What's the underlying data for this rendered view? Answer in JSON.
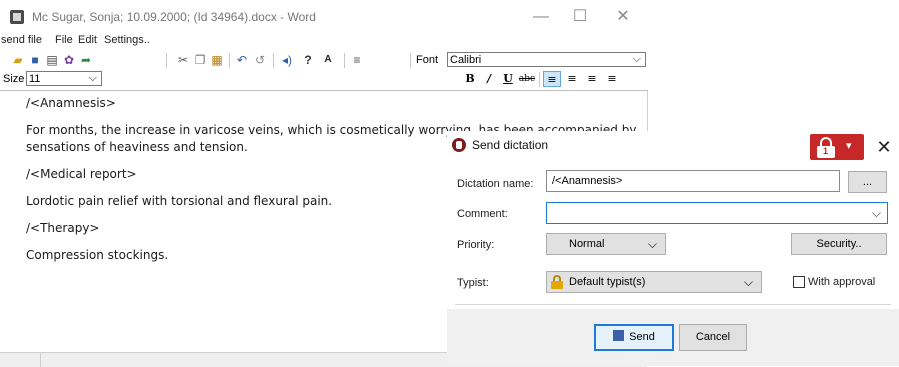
{
  "word": {
    "window_title": "Mc Sugar, Sonja; 10.09.2000; (Id 34964).docx - Word",
    "controls": {
      "minimize": "—",
      "maximize": "☐",
      "close": "✕"
    },
    "menu": [
      "send file",
      "File",
      "Edit",
      "Settings.."
    ],
    "toolbar": {
      "font_label": "Font",
      "font_value": "Calibri",
      "size_label": "Size",
      "size_value": "11",
      "format_buttons": [
        "B",
        "/",
        "U",
        "abc"
      ]
    },
    "document": {
      "paragraphs": [
        "/<Anamnesis>",
        "For months, the increase in varicose veins, which is cosmetically worrying, has been accompanied by",
        "sensations of heaviness and tension.",
        "/<Medical report>",
        "Lordotic pain relief with torsional and flexural pain.",
        "/<Therapy>",
        "Compression stockings."
      ]
    }
  },
  "dialog": {
    "title": "Send dictation",
    "lock_badge": "1",
    "close": "✕",
    "dictation_name_label": "Dictation name:",
    "dictation_name_value": "/<Anamnesis>",
    "browse_label": "...",
    "comment_label": "Comment:",
    "comment_value": "",
    "priority_label": "Priority:",
    "priority_value": "Normal",
    "security_label": "Security..",
    "typist_label": "Typist:",
    "typist_value": "Default typist(s)",
    "with_approval_label": "With approval",
    "with_approval_checked": false,
    "send_label": "Send",
    "cancel_label": "Cancel"
  },
  "colors": {
    "accent": "#1e7ad6",
    "lock_red": "#c62828"
  }
}
